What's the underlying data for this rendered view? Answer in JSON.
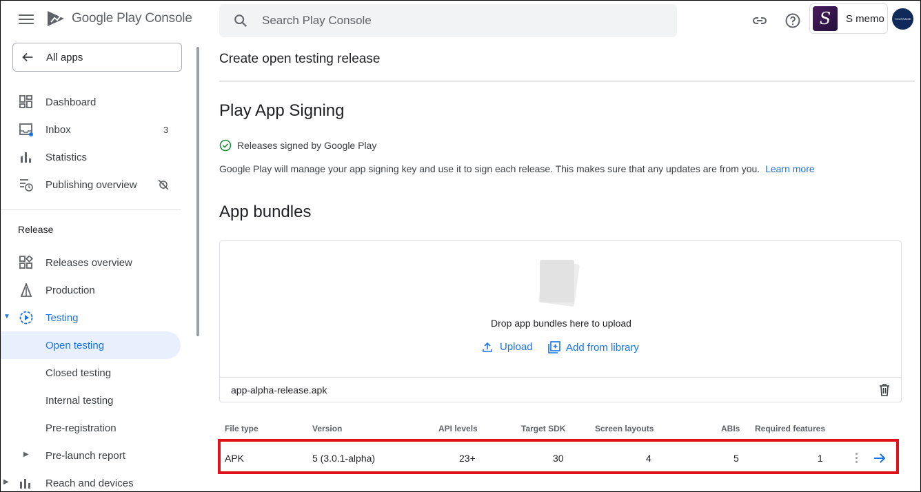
{
  "header": {
    "brand": "Google Play Console",
    "search_placeholder": "Search Play Console",
    "account_name": "S memo",
    "app_initial": "S",
    "avatar_text": "YOURNAME"
  },
  "sidebar": {
    "all_apps": "All apps",
    "items": [
      {
        "label": "Dashboard",
        "icon": "dashboard-icon"
      },
      {
        "label": "Inbox",
        "icon": "inbox-icon",
        "count": "3"
      },
      {
        "label": "Statistics",
        "icon": "bar-chart-icon"
      },
      {
        "label": "Publishing overview",
        "icon": "publishing-overview-icon"
      }
    ],
    "release_section": "Release",
    "release_items": [
      {
        "label": "Releases overview",
        "icon": "releases-overview-icon"
      },
      {
        "label": "Production",
        "icon": "production-icon"
      },
      {
        "label": "Testing",
        "icon": "testing-icon"
      },
      {
        "label": "Open testing"
      },
      {
        "label": "Closed testing"
      },
      {
        "label": "Internal testing"
      },
      {
        "label": "Pre-registration"
      },
      {
        "label": "Pre-launch report"
      },
      {
        "label": "Reach and devices",
        "icon": "reach-devices-icon"
      }
    ]
  },
  "main": {
    "page_title": "Create open testing release",
    "signing": {
      "heading": "Play App Signing",
      "status": "Releases signed by Google Play",
      "description": "Google Play will manage your app signing key and use it to sign each release. This makes sure that any updates are from you.",
      "learn_more": "Learn more"
    },
    "bundles": {
      "heading": "App bundles",
      "drop_text": "Drop app bundles here to upload",
      "upload_label": "Upload",
      "library_label": "Add from library",
      "file_name": "app-alpha-release.apk"
    },
    "table": {
      "headers": [
        "File type",
        "Version",
        "API levels",
        "Target SDK",
        "Screen layouts",
        "ABIs",
        "Required features"
      ],
      "row": [
        "APK",
        "5 (3.0.1-alpha)",
        "23+",
        "30",
        "4",
        "5",
        "1"
      ]
    }
  },
  "colors": {
    "accent": "#1a73e8",
    "highlight_box": "#e0111b",
    "success": "#1e8e3e"
  }
}
